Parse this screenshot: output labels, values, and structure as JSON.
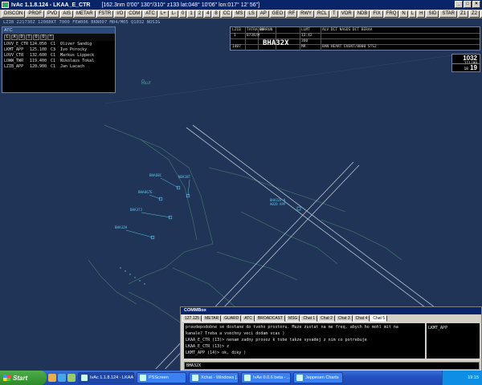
{
  "window": {
    "title": "IvAc 1.1.8.124 - LKAA_E_CTR",
    "title_info": "[162.3nm    0'00\"  130°/310°   z133   lat:048° 10'06\" lon:017° 12' 56\"]"
  },
  "toolbar": {
    "buttons": [
      "DISCON",
      "PROF",
      "PVD",
      "AIS",
      "METAR",
      "FSTR",
      "I/O",
      "COM",
      "ATC",
      "L+",
      "L-",
      "0",
      "1",
      "2",
      "4",
      "8",
      "CC",
      "MS",
      "LS",
      "AP",
      "GEO",
      "RF",
      "RWY",
      "RCL",
      "T",
      "VOR",
      "NDB",
      "FIX",
      "FRQ",
      "N",
      "L",
      "H",
      "SID",
      "STAR",
      "Z1",
      "Z2",
      "Z3",
      "Z4"
    ]
  },
  "statusline": "LZIB 221730Z 12008KT 7000 FEW006 BKN007 M04/M05 Q1032 NOSIG",
  "atc_window": {
    "title": "ATC",
    "tabs": [
      "C",
      "A",
      "D",
      "T",
      "O",
      "O",
      "*"
    ],
    "rows": [
      {
        "callsign": "LOVV_E_CTR",
        "freq": "124.050",
        "rating": "C1",
        "name": "Oliver Sandig"
      },
      {
        "callsign": "LKMT_APP",
        "freq": "125.100",
        "rating": "C3",
        "name": "Ivo Porocky"
      },
      {
        "callsign": "LOVV_CTR",
        "freq": "132.600",
        "rating": "C1",
        "name": "Markus Lippeck"
      },
      {
        "callsign": "LOWW_TWR",
        "freq": "119.400",
        "rating": "C1",
        "name": "Nikolaus Tokal"
      },
      {
        "callsign": "LZIB_APP",
        "freq": "120.900",
        "rating": "C1",
        "name": "Jan Lacach"
      }
    ]
  },
  "flight_strip": {
    "ades": "LZIB",
    "cfl": "1",
    "squawk_row": "TATRA 00",
    "route_head": "NORRUN",
    "route_tail": "LLMT",
    "callsign": "BHA32X",
    "type": "B738/M",
    "time": "1407",
    "alt": "360",
    "dest": "MR",
    "route": "ALV DCT NAGOS DCT BERAA",
    "remarks": "BAN HEART EVENT/0000 STS2",
    "eta": "12:42"
  },
  "qnh": {
    "value": "1032",
    "sub": "111/09",
    "wind_label": "18",
    "wind_value": "19"
  },
  "radar": {
    "labels": [
      {
        "text": "BHA68C",
        "kind": "aircraft"
      },
      {
        "text": "NEK38T",
        "kind": "aircraft"
      },
      {
        "text": "BHA067E",
        "kind": "aircraft"
      },
      {
        "text": "BHA37J",
        "kind": "aircraft"
      },
      {
        "text": "BHA32H",
        "kind": "aircraft"
      },
      {
        "text": "BHA46R",
        "kind": "aircraft"
      },
      {
        "text": "BHA32X A",
        "kind": "selected"
      },
      {
        "text": "A028 APP",
        "kind": "selected"
      },
      {
        "text": "LOLUT",
        "kind": "fix"
      }
    ]
  },
  "comms": {
    "title": "COMMBox",
    "tabs": [
      "127.125",
      "METAR",
      "GUARD",
      "ATC",
      "BROADCAST",
      "MSG",
      "Chat 1",
      "Chat 2",
      "Chat 3",
      "Chat 4",
      "Chat 5"
    ],
    "active_tab": "Chat 5",
    "messages": [
      "pravdepodobne se dostane do tveho prostoru. Muze zustat na me freq, abych ho mohl mit na",
      "kanale? Treba a vsechny veci dodam vcas  )",
      "LKAA_E_CTR (13)> nenam zadny provoz k tobe takze vyvadej z nim co potrebuje",
      "LKAA_E_CTR (13)> z",
      "LKMT_APP (14)> ok, diky  )"
    ],
    "users": [
      "LKMT_APP"
    ],
    "input": "BHA32X"
  },
  "taskbar": {
    "start": "Start",
    "tasks": [
      {
        "label": "IvAc 1.1.8.124 - LKAA...",
        "active": true
      },
      {
        "label": "PSScreen",
        "active": false
      },
      {
        "label": "Xchat - Windows [...]",
        "active": false
      },
      {
        "label": "IvAe 0.0.6 beta - ...",
        "active": false
      },
      {
        "label": "Jeppesen Charts",
        "active": false
      }
    ],
    "clock": "19:15"
  },
  "colors": {
    "scope_bg": "#1f3457",
    "runway": "#b8c4d2",
    "taxiway": "#3f6a6a",
    "aircraft": "#5fc3e8",
    "titlebar": "#0a246a"
  }
}
